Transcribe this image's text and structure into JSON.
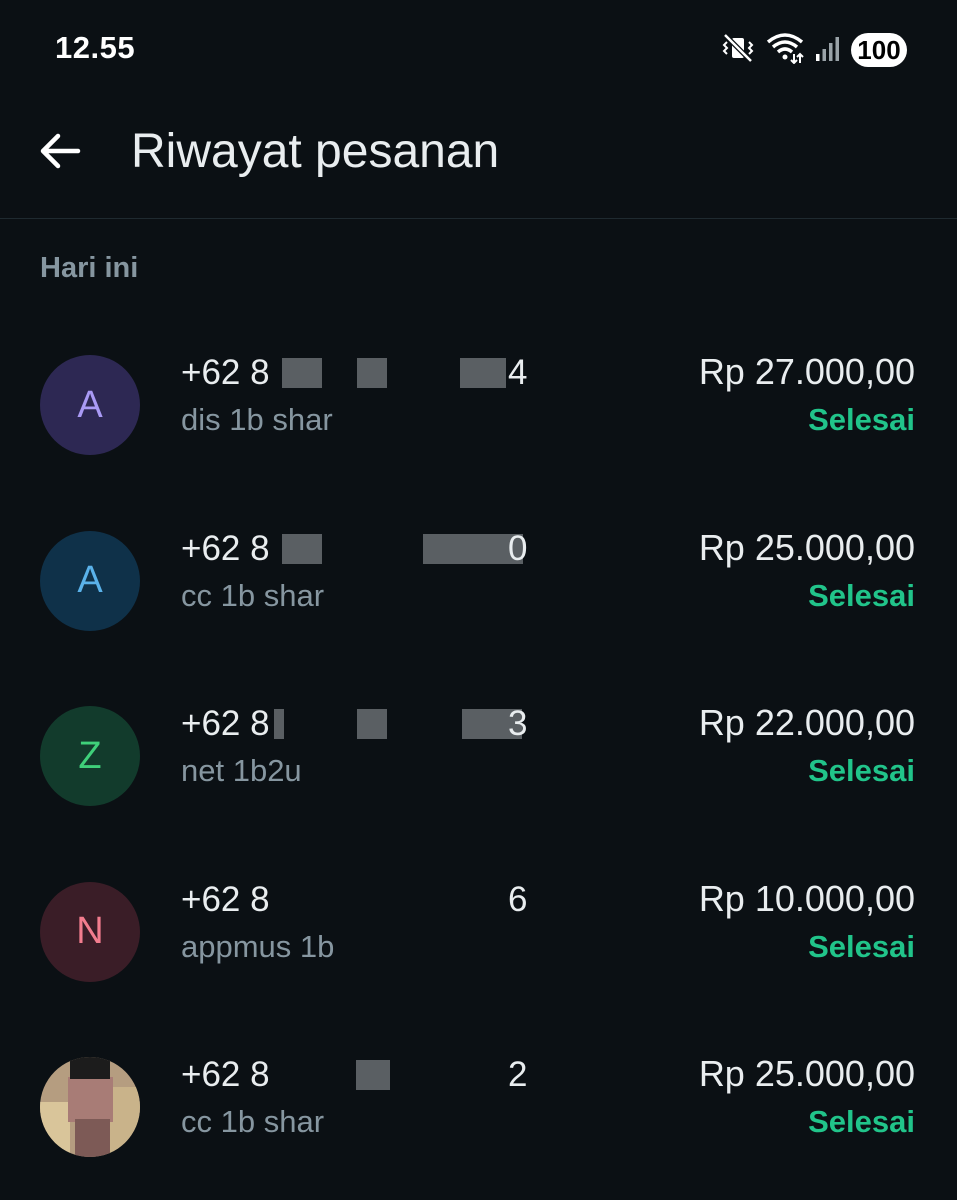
{
  "status_bar": {
    "time": "12.55",
    "battery": "100"
  },
  "header": {
    "title": "Riwayat pesanan"
  },
  "section": {
    "label": "Hari ini"
  },
  "orders": [
    {
      "avatar_letter": "A",
      "phone_prefix": "+62 8",
      "phone_suffix": "4",
      "product": "dis 1b shar",
      "amount": "Rp 27.000,00",
      "status": "Selesai",
      "avatar_bg": "#2d2853",
      "avatar_fg": "#a99af5"
    },
    {
      "avatar_letter": "A",
      "phone_prefix": "+62 8",
      "phone_suffix": "0",
      "product": "cc 1b shar",
      "amount": "Rp 25.000,00",
      "status": "Selesai",
      "avatar_bg": "#0f3149",
      "avatar_fg": "#5ab2ea"
    },
    {
      "avatar_letter": "Z",
      "phone_prefix": "+62 8",
      "phone_suffix": "3",
      "product": "net 1b2u",
      "amount": "Rp 22.000,00",
      "status": "Selesai",
      "avatar_bg": "#123b2c",
      "avatar_fg": "#3fd07a"
    },
    {
      "avatar_letter": "N",
      "phone_prefix": "+62 8",
      "phone_suffix": "6",
      "product": "appmus 1b",
      "amount": "Rp 10.000,00",
      "status": "Selesai",
      "avatar_bg": "#3a1d27",
      "avatar_fg": "#f27d8e"
    },
    {
      "avatar_letter": "",
      "phone_prefix": "+62 8",
      "phone_suffix": "2",
      "product": "cc 1b shar",
      "amount": "Rp 25.000,00",
      "status": "Selesai",
      "avatar_bg": "#6b5a4a",
      "avatar_fg": "#ffffff"
    }
  ],
  "icons": {
    "back": "arrow-left-icon",
    "mute": "vibrate-mute-icon",
    "wifi": "wifi-icon",
    "signal": "signal-icon"
  },
  "colors": {
    "background": "#0b1014",
    "accent_status": "#21c48a",
    "secondary_text": "#8696a0"
  }
}
